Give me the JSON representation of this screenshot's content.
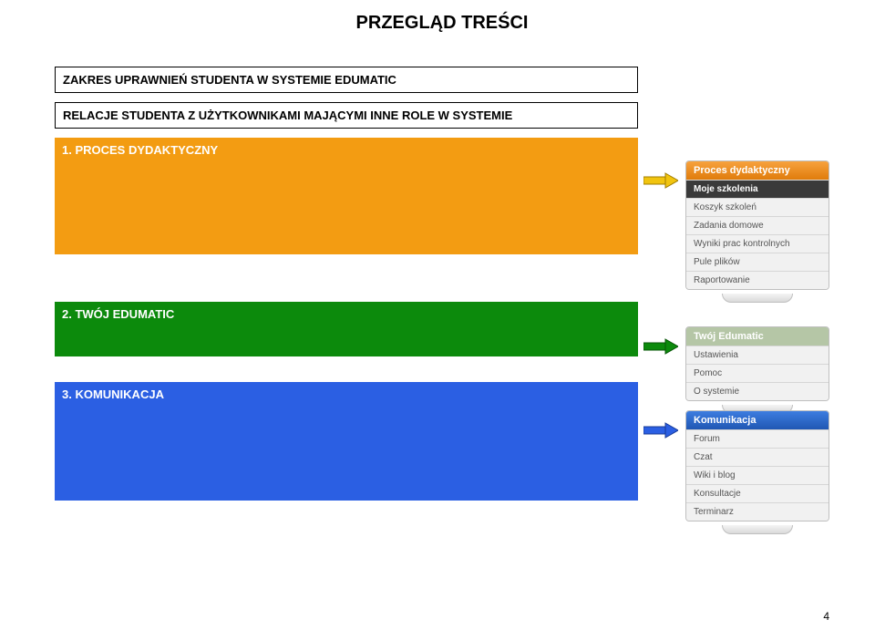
{
  "title": "PRZEGLĄD TREŚCI",
  "boxes": {
    "a": "ZAKRES UPRAWNIEŃ STUDENTA W SYSTEMIE EDUMATIC",
    "b": "RELACJE STUDENTA Z UŻYTKOWNIKAMI MAJĄCYMI INNE ROLE W SYSTEMIE"
  },
  "sections": {
    "s1": "1. PROCES DYDAKTYCZNY",
    "s2": "2. TWÓJ EDUMATIC",
    "s3": "3. KOMUNIKACJA"
  },
  "panels": {
    "proces": {
      "header": "Proces dydaktyczny",
      "items": [
        "Moje szkolenia",
        "Koszyk szkoleń",
        "Zadania domowe",
        "Wyniki prac kontrolnych",
        "Pule plików",
        "Raportowanie"
      ],
      "active": 0
    },
    "twoj": {
      "header": "Twój Edumatic",
      "items": [
        "Ustawienia",
        "Pomoc",
        "O systemie"
      ]
    },
    "kom": {
      "header": "Komunikacja",
      "items": [
        "Forum",
        "Czat",
        "Wiki i blog",
        "Konsultacje",
        "Terminarz"
      ]
    }
  },
  "arrowColors": {
    "a1": "#f1c40f",
    "a2": "#0c8a0c",
    "a3": "#2b5fe3"
  },
  "pageNumber": "4"
}
